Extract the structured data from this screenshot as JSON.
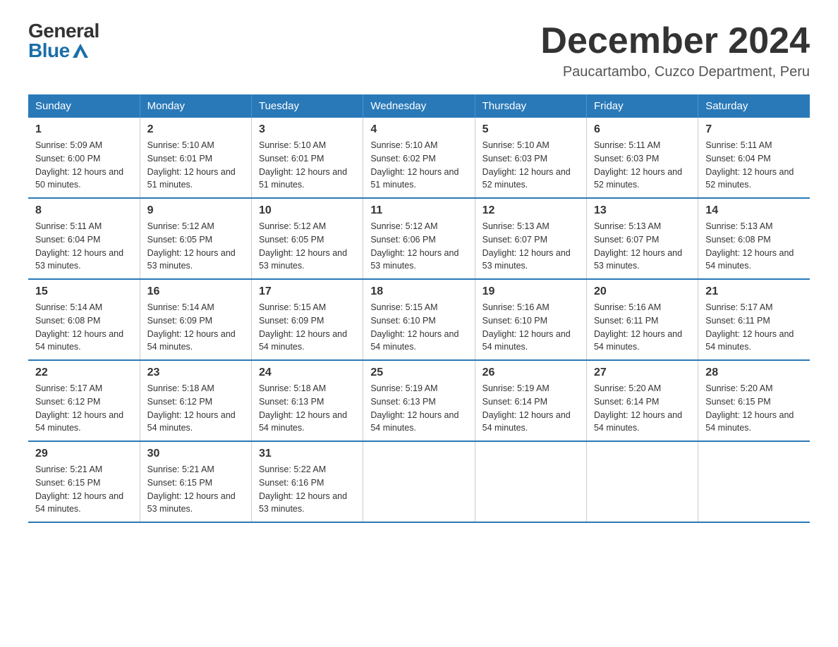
{
  "header": {
    "logo_general": "General",
    "logo_blue": "Blue",
    "title": "December 2024",
    "subtitle": "Paucartambo, Cuzco Department, Peru"
  },
  "calendar": {
    "days_of_week": [
      "Sunday",
      "Monday",
      "Tuesday",
      "Wednesday",
      "Thursday",
      "Friday",
      "Saturday"
    ],
    "weeks": [
      [
        {
          "day": "1",
          "sunrise": "Sunrise: 5:09 AM",
          "sunset": "Sunset: 6:00 PM",
          "daylight": "Daylight: 12 hours and 50 minutes."
        },
        {
          "day": "2",
          "sunrise": "Sunrise: 5:10 AM",
          "sunset": "Sunset: 6:01 PM",
          "daylight": "Daylight: 12 hours and 51 minutes."
        },
        {
          "day": "3",
          "sunrise": "Sunrise: 5:10 AM",
          "sunset": "Sunset: 6:01 PM",
          "daylight": "Daylight: 12 hours and 51 minutes."
        },
        {
          "day": "4",
          "sunrise": "Sunrise: 5:10 AM",
          "sunset": "Sunset: 6:02 PM",
          "daylight": "Daylight: 12 hours and 51 minutes."
        },
        {
          "day": "5",
          "sunrise": "Sunrise: 5:10 AM",
          "sunset": "Sunset: 6:03 PM",
          "daylight": "Daylight: 12 hours and 52 minutes."
        },
        {
          "day": "6",
          "sunrise": "Sunrise: 5:11 AM",
          "sunset": "Sunset: 6:03 PM",
          "daylight": "Daylight: 12 hours and 52 minutes."
        },
        {
          "day": "7",
          "sunrise": "Sunrise: 5:11 AM",
          "sunset": "Sunset: 6:04 PM",
          "daylight": "Daylight: 12 hours and 52 minutes."
        }
      ],
      [
        {
          "day": "8",
          "sunrise": "Sunrise: 5:11 AM",
          "sunset": "Sunset: 6:04 PM",
          "daylight": "Daylight: 12 hours and 53 minutes."
        },
        {
          "day": "9",
          "sunrise": "Sunrise: 5:12 AM",
          "sunset": "Sunset: 6:05 PM",
          "daylight": "Daylight: 12 hours and 53 minutes."
        },
        {
          "day": "10",
          "sunrise": "Sunrise: 5:12 AM",
          "sunset": "Sunset: 6:05 PM",
          "daylight": "Daylight: 12 hours and 53 minutes."
        },
        {
          "day": "11",
          "sunrise": "Sunrise: 5:12 AM",
          "sunset": "Sunset: 6:06 PM",
          "daylight": "Daylight: 12 hours and 53 minutes."
        },
        {
          "day": "12",
          "sunrise": "Sunrise: 5:13 AM",
          "sunset": "Sunset: 6:07 PM",
          "daylight": "Daylight: 12 hours and 53 minutes."
        },
        {
          "day": "13",
          "sunrise": "Sunrise: 5:13 AM",
          "sunset": "Sunset: 6:07 PM",
          "daylight": "Daylight: 12 hours and 53 minutes."
        },
        {
          "day": "14",
          "sunrise": "Sunrise: 5:13 AM",
          "sunset": "Sunset: 6:08 PM",
          "daylight": "Daylight: 12 hours and 54 minutes."
        }
      ],
      [
        {
          "day": "15",
          "sunrise": "Sunrise: 5:14 AM",
          "sunset": "Sunset: 6:08 PM",
          "daylight": "Daylight: 12 hours and 54 minutes."
        },
        {
          "day": "16",
          "sunrise": "Sunrise: 5:14 AM",
          "sunset": "Sunset: 6:09 PM",
          "daylight": "Daylight: 12 hours and 54 minutes."
        },
        {
          "day": "17",
          "sunrise": "Sunrise: 5:15 AM",
          "sunset": "Sunset: 6:09 PM",
          "daylight": "Daylight: 12 hours and 54 minutes."
        },
        {
          "day": "18",
          "sunrise": "Sunrise: 5:15 AM",
          "sunset": "Sunset: 6:10 PM",
          "daylight": "Daylight: 12 hours and 54 minutes."
        },
        {
          "day": "19",
          "sunrise": "Sunrise: 5:16 AM",
          "sunset": "Sunset: 6:10 PM",
          "daylight": "Daylight: 12 hours and 54 minutes."
        },
        {
          "day": "20",
          "sunrise": "Sunrise: 5:16 AM",
          "sunset": "Sunset: 6:11 PM",
          "daylight": "Daylight: 12 hours and 54 minutes."
        },
        {
          "day": "21",
          "sunrise": "Sunrise: 5:17 AM",
          "sunset": "Sunset: 6:11 PM",
          "daylight": "Daylight: 12 hours and 54 minutes."
        }
      ],
      [
        {
          "day": "22",
          "sunrise": "Sunrise: 5:17 AM",
          "sunset": "Sunset: 6:12 PM",
          "daylight": "Daylight: 12 hours and 54 minutes."
        },
        {
          "day": "23",
          "sunrise": "Sunrise: 5:18 AM",
          "sunset": "Sunset: 6:12 PM",
          "daylight": "Daylight: 12 hours and 54 minutes."
        },
        {
          "day": "24",
          "sunrise": "Sunrise: 5:18 AM",
          "sunset": "Sunset: 6:13 PM",
          "daylight": "Daylight: 12 hours and 54 minutes."
        },
        {
          "day": "25",
          "sunrise": "Sunrise: 5:19 AM",
          "sunset": "Sunset: 6:13 PM",
          "daylight": "Daylight: 12 hours and 54 minutes."
        },
        {
          "day": "26",
          "sunrise": "Sunrise: 5:19 AM",
          "sunset": "Sunset: 6:14 PM",
          "daylight": "Daylight: 12 hours and 54 minutes."
        },
        {
          "day": "27",
          "sunrise": "Sunrise: 5:20 AM",
          "sunset": "Sunset: 6:14 PM",
          "daylight": "Daylight: 12 hours and 54 minutes."
        },
        {
          "day": "28",
          "sunrise": "Sunrise: 5:20 AM",
          "sunset": "Sunset: 6:15 PM",
          "daylight": "Daylight: 12 hours and 54 minutes."
        }
      ],
      [
        {
          "day": "29",
          "sunrise": "Sunrise: 5:21 AM",
          "sunset": "Sunset: 6:15 PM",
          "daylight": "Daylight: 12 hours and 54 minutes."
        },
        {
          "day": "30",
          "sunrise": "Sunrise: 5:21 AM",
          "sunset": "Sunset: 6:15 PM",
          "daylight": "Daylight: 12 hours and 53 minutes."
        },
        {
          "day": "31",
          "sunrise": "Sunrise: 5:22 AM",
          "sunset": "Sunset: 6:16 PM",
          "daylight": "Daylight: 12 hours and 53 minutes."
        },
        null,
        null,
        null,
        null
      ]
    ]
  }
}
